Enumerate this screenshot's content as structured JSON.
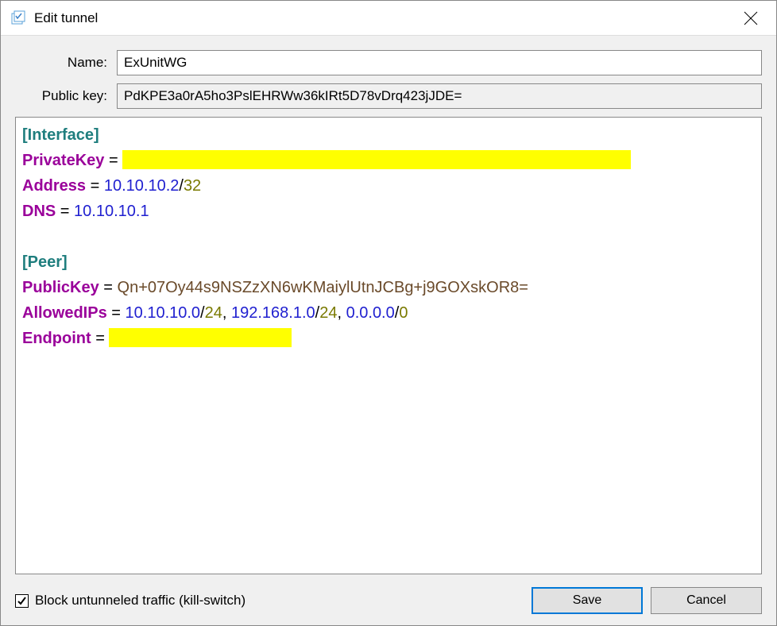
{
  "window": {
    "title": "Edit tunnel"
  },
  "fields": {
    "name_label": "Name:",
    "name_value": "ExUnitWG",
    "pubkey_label": "Public key:",
    "pubkey_value": "PdKPE3a0rA5ho3PslEHRWw36kIRt5D78vDrq423jJDE="
  },
  "config": {
    "interface_header": "[Interface]",
    "private_key_label": "PrivateKey",
    "address_label": "Address",
    "address_ip": "10.10.10.2",
    "address_mask": "32",
    "dns_label": "DNS",
    "dns_ip": "10.10.10.1",
    "peer_header": "[Peer]",
    "peer_pubkey_label": "PublicKey",
    "peer_pubkey_value": "Qn+07Oy44s9NSZzXN6wKMaiylUtnJCBg+j9GOXskOR8=",
    "allowed_label": "AllowedIPs",
    "allowed_ip1": "10.10.10.0",
    "allowed_mask1": "24",
    "allowed_ip2": "192.168.1.0",
    "allowed_mask2": "24",
    "allowed_ip3": "0.0.0.0",
    "allowed_mask3": "0",
    "endpoint_label": "Endpoint"
  },
  "footer": {
    "kill_switch_label": "Block untunneled traffic (kill-switch)",
    "kill_switch_checked": true,
    "save_label": "Save",
    "cancel_label": "Cancel"
  }
}
